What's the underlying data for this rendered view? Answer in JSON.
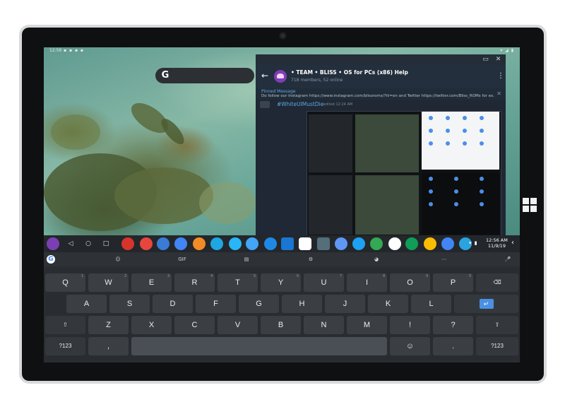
{
  "statusbar": {
    "time": "12:56",
    "left_icons": "▪ ▪ ▪ ▪",
    "right_icons": "▾ ◢ ▮"
  },
  "search": {
    "logo": "G"
  },
  "telegram": {
    "window_buttons": [
      "▭",
      "✕"
    ],
    "back": "←",
    "title": "• TEAM • BLISS • OS for PCs (x86) Help",
    "subtitle": "718 members, 52 online",
    "menu": "⋮",
    "pinned_label": "Pinned Message",
    "pinned_text": "Do follow our Instagram https://www.instagram.com/blissroms/?hl=en  and  Twitter https://twitter.com/Bliss_ROMs for ex...",
    "pinned_close": "✕",
    "message_tag": "#WhiteUIMustDie",
    "message_meta": "edited 12:24 AM"
  },
  "taskbar": {
    "nav": [
      "◁",
      "○",
      "□"
    ],
    "apps": [
      {
        "name": "bliss-launcher-icon",
        "color": "#7b3fb3"
      },
      {
        "name": "equalizer-app-icon",
        "color": "#d9342b"
      },
      {
        "name": "chrome-icon",
        "color": "#e8453c"
      },
      {
        "name": "rotation-app-icon",
        "color": "#3a7bd5"
      },
      {
        "name": "palette-app-icon",
        "color": "#4285f4"
      },
      {
        "name": "game-app-icon",
        "color": "#f28b25"
      },
      {
        "name": "bliss-settings-icon",
        "color": "#1ea7e1"
      },
      {
        "name": "browser-app-icon",
        "color": "#29b6f6"
      },
      {
        "name": "gallery-app-icon",
        "color": "#42a5f5"
      },
      {
        "name": "bliss-app-icon",
        "color": "#1e88e5"
      },
      {
        "name": "files-app-icon",
        "color": "#1976d2"
      },
      {
        "name": "slack-icon",
        "color": "#ffffff"
      },
      {
        "name": "terminal-app-icon",
        "color": "#546e7a"
      },
      {
        "name": "security-app-icon",
        "color": "#5e97f6"
      },
      {
        "name": "twitter-icon",
        "color": "#1da1f2"
      },
      {
        "name": "play-store-icon",
        "color": "#34a853"
      },
      {
        "name": "gmail-icon",
        "color": "#ffffff"
      },
      {
        "name": "hangouts-icon",
        "color": "#0f9d58"
      },
      {
        "name": "keep-icon",
        "color": "#fbbc04"
      },
      {
        "name": "settings-icon",
        "color": "#4285f4"
      },
      {
        "name": "telegram-icon",
        "color": "#2aa3df"
      }
    ],
    "status_icons": "▾ ▮",
    "time": "12:56 AM",
    "date": "11/9/19",
    "chevron": "‹"
  },
  "keyboard": {
    "google": "G",
    "toolbar": [
      "☺",
      "GIF",
      "▤",
      "⚙",
      "◕",
      "⋯",
      "🎤"
    ],
    "row1": [
      {
        "k": "Q",
        "h": "1"
      },
      {
        "k": "W",
        "h": "2"
      },
      {
        "k": "E",
        "h": "3"
      },
      {
        "k": "R",
        "h": "4"
      },
      {
        "k": "T",
        "h": "5"
      },
      {
        "k": "Y",
        "h": "6"
      },
      {
        "k": "U",
        "h": "7"
      },
      {
        "k": "I",
        "h": "8"
      },
      {
        "k": "O",
        "h": "9"
      },
      {
        "k": "P",
        "h": "0"
      },
      {
        "k": "⌫",
        "h": ""
      }
    ],
    "row2": [
      "A",
      "S",
      "D",
      "F",
      "G",
      "H",
      "J",
      "K",
      "L",
      "↵"
    ],
    "row3": [
      "⇧",
      "Z",
      "X",
      "C",
      "V",
      "B",
      "N",
      "M",
      "!",
      "?",
      "⇧"
    ],
    "row4": [
      "?123",
      ",",
      "",
      ".",
      "?123"
    ],
    "emoji": "☺"
  }
}
